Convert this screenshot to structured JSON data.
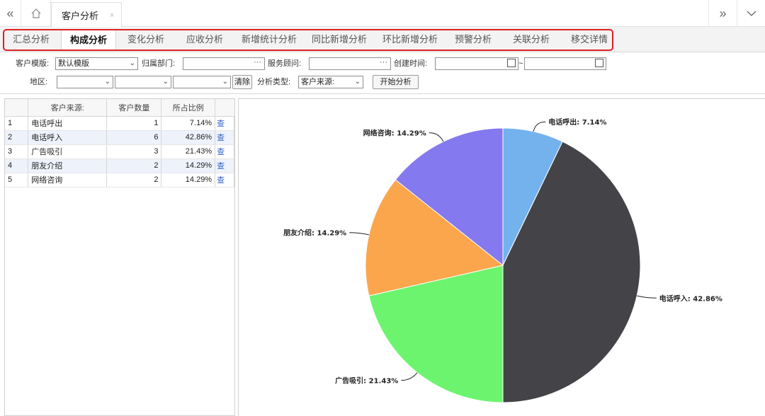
{
  "topbar": {
    "left_icon": "double-chevron-left-icon",
    "home_icon": "home-icon",
    "active_tab": "客户分析",
    "close_glyph": "×",
    "right_icon": "double-chevron-right-icon",
    "down_icon": "chevron-down-icon"
  },
  "subtabs": [
    "汇总分析",
    "构成分析",
    "变化分析",
    "应收分析",
    "新增统计分析",
    "同比新增分析",
    "环比新增分析",
    "预警分析",
    "关联分析",
    "移交详情"
  ],
  "active_subtab": 1,
  "filters": {
    "template_label": "客户模版:",
    "template_value": "默认模版",
    "dept_label": "归属部门:",
    "dept_value": "",
    "advisor_label": "服务顾问:",
    "advisor_value": "",
    "created_label": "创建时间:",
    "created_from": "",
    "range_sep": "~",
    "created_to": "",
    "region_label": "地区:",
    "region_1": "",
    "region_2": "",
    "region_3": "",
    "clear_button": "清除",
    "analysis_type_label": "分析类型:",
    "analysis_type_value": "客户来源:",
    "start_button": "开始分析"
  },
  "table": {
    "columns": [
      "",
      "客户来源:",
      "客户数量",
      "所占比例",
      ""
    ],
    "link_text": "查",
    "rows": [
      {
        "idx": "1",
        "source": "电话呼出",
        "count": "1",
        "ratio": "7.14%"
      },
      {
        "idx": "2",
        "source": "电话呼入",
        "count": "6",
        "ratio": "42.86%"
      },
      {
        "idx": "3",
        "source": "广告吸引",
        "count": "3",
        "ratio": "21.43%"
      },
      {
        "idx": "4",
        "source": "朋友介绍",
        "count": "2",
        "ratio": "14.29%"
      },
      {
        "idx": "5",
        "source": "网络咨询",
        "count": "2",
        "ratio": "14.29%"
      }
    ]
  },
  "chart_data": {
    "type": "pie",
    "categories": [
      "电话呼出",
      "电话呼入",
      "广告吸引",
      "朋友介绍",
      "网络咨询"
    ],
    "values": [
      1,
      6,
      3,
      2,
      2
    ],
    "labels": [
      "电话呼出: 7.14%",
      "电话呼入: 42.86%",
      "广告吸引: 21.43%",
      "朋友介绍: 14.29%",
      "网络咨询: 14.29%"
    ],
    "colors": [
      "#74b2ee",
      "#434348",
      "#6cf46f",
      "#fba64c",
      "#8479ef"
    ]
  }
}
